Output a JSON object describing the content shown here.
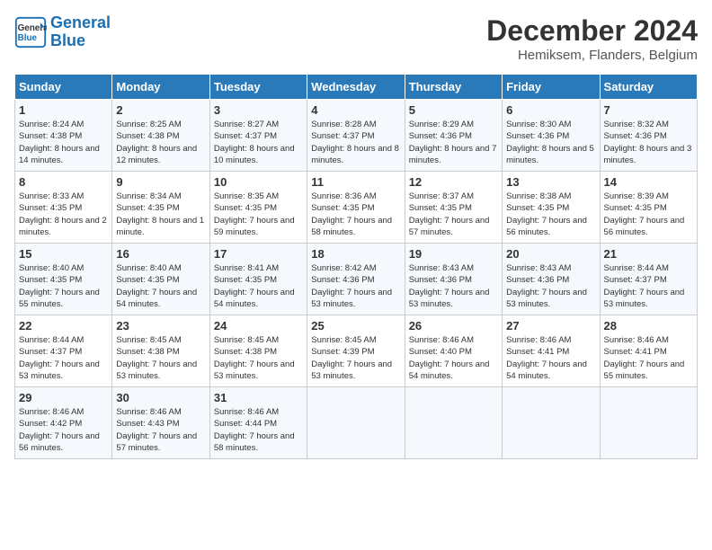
{
  "logo": {
    "line1": "General",
    "line2": "Blue"
  },
  "title": "December 2024",
  "subtitle": "Hemiksem, Flanders, Belgium",
  "days_of_week": [
    "Sunday",
    "Monday",
    "Tuesday",
    "Wednesday",
    "Thursday",
    "Friday",
    "Saturday"
  ],
  "weeks": [
    [
      {
        "day": "1",
        "sunrise": "8:24 AM",
        "sunset": "4:38 PM",
        "daylight": "8 hours and 14 minutes."
      },
      {
        "day": "2",
        "sunrise": "8:25 AM",
        "sunset": "4:38 PM",
        "daylight": "8 hours and 12 minutes."
      },
      {
        "day": "3",
        "sunrise": "8:27 AM",
        "sunset": "4:37 PM",
        "daylight": "8 hours and 10 minutes."
      },
      {
        "day": "4",
        "sunrise": "8:28 AM",
        "sunset": "4:37 PM",
        "daylight": "8 hours and 8 minutes."
      },
      {
        "day": "5",
        "sunrise": "8:29 AM",
        "sunset": "4:36 PM",
        "daylight": "8 hours and 7 minutes."
      },
      {
        "day": "6",
        "sunrise": "8:30 AM",
        "sunset": "4:36 PM",
        "daylight": "8 hours and 5 minutes."
      },
      {
        "day": "7",
        "sunrise": "8:32 AM",
        "sunset": "4:36 PM",
        "daylight": "8 hours and 3 minutes."
      }
    ],
    [
      {
        "day": "8",
        "sunrise": "8:33 AM",
        "sunset": "4:35 PM",
        "daylight": "8 hours and 2 minutes."
      },
      {
        "day": "9",
        "sunrise": "8:34 AM",
        "sunset": "4:35 PM",
        "daylight": "8 hours and 1 minute."
      },
      {
        "day": "10",
        "sunrise": "8:35 AM",
        "sunset": "4:35 PM",
        "daylight": "7 hours and 59 minutes."
      },
      {
        "day": "11",
        "sunrise": "8:36 AM",
        "sunset": "4:35 PM",
        "daylight": "7 hours and 58 minutes."
      },
      {
        "day": "12",
        "sunrise": "8:37 AM",
        "sunset": "4:35 PM",
        "daylight": "7 hours and 57 minutes."
      },
      {
        "day": "13",
        "sunrise": "8:38 AM",
        "sunset": "4:35 PM",
        "daylight": "7 hours and 56 minutes."
      },
      {
        "day": "14",
        "sunrise": "8:39 AM",
        "sunset": "4:35 PM",
        "daylight": "7 hours and 56 minutes."
      }
    ],
    [
      {
        "day": "15",
        "sunrise": "8:40 AM",
        "sunset": "4:35 PM",
        "daylight": "7 hours and 55 minutes."
      },
      {
        "day": "16",
        "sunrise": "8:40 AM",
        "sunset": "4:35 PM",
        "daylight": "7 hours and 54 minutes."
      },
      {
        "day": "17",
        "sunrise": "8:41 AM",
        "sunset": "4:35 PM",
        "daylight": "7 hours and 54 minutes."
      },
      {
        "day": "18",
        "sunrise": "8:42 AM",
        "sunset": "4:36 PM",
        "daylight": "7 hours and 53 minutes."
      },
      {
        "day": "19",
        "sunrise": "8:43 AM",
        "sunset": "4:36 PM",
        "daylight": "7 hours and 53 minutes."
      },
      {
        "day": "20",
        "sunrise": "8:43 AM",
        "sunset": "4:36 PM",
        "daylight": "7 hours and 53 minutes."
      },
      {
        "day": "21",
        "sunrise": "8:44 AM",
        "sunset": "4:37 PM",
        "daylight": "7 hours and 53 minutes."
      }
    ],
    [
      {
        "day": "22",
        "sunrise": "8:44 AM",
        "sunset": "4:37 PM",
        "daylight": "7 hours and 53 minutes."
      },
      {
        "day": "23",
        "sunrise": "8:45 AM",
        "sunset": "4:38 PM",
        "daylight": "7 hours and 53 minutes."
      },
      {
        "day": "24",
        "sunrise": "8:45 AM",
        "sunset": "4:38 PM",
        "daylight": "7 hours and 53 minutes."
      },
      {
        "day": "25",
        "sunrise": "8:45 AM",
        "sunset": "4:39 PM",
        "daylight": "7 hours and 53 minutes."
      },
      {
        "day": "26",
        "sunrise": "8:46 AM",
        "sunset": "4:40 PM",
        "daylight": "7 hours and 54 minutes."
      },
      {
        "day": "27",
        "sunrise": "8:46 AM",
        "sunset": "4:41 PM",
        "daylight": "7 hours and 54 minutes."
      },
      {
        "day": "28",
        "sunrise": "8:46 AM",
        "sunset": "4:41 PM",
        "daylight": "7 hours and 55 minutes."
      }
    ],
    [
      {
        "day": "29",
        "sunrise": "8:46 AM",
        "sunset": "4:42 PM",
        "daylight": "7 hours and 56 minutes."
      },
      {
        "day": "30",
        "sunrise": "8:46 AM",
        "sunset": "4:43 PM",
        "daylight": "7 hours and 57 minutes."
      },
      {
        "day": "31",
        "sunrise": "8:46 AM",
        "sunset": "4:44 PM",
        "daylight": "7 hours and 58 minutes."
      },
      null,
      null,
      null,
      null
    ]
  ],
  "labels": {
    "sunrise": "Sunrise:",
    "sunset": "Sunset:",
    "daylight": "Daylight:"
  }
}
